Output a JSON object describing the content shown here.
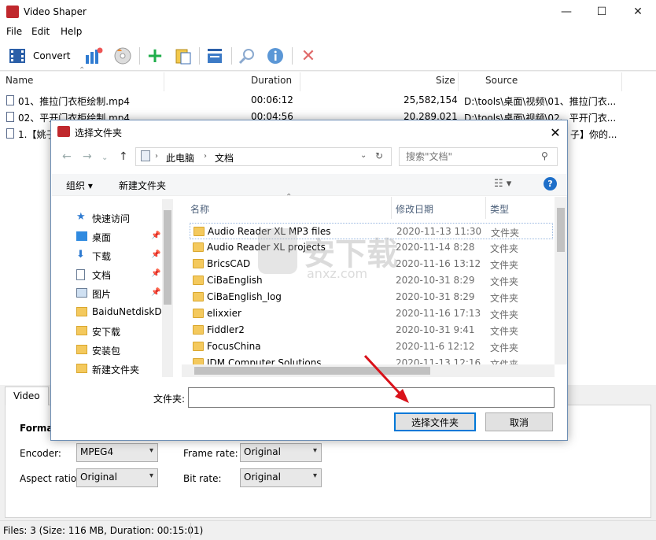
{
  "app": {
    "title": "Video Shaper"
  },
  "window_controls": {
    "minimize": "—",
    "maximize": "☐",
    "close": "✕"
  },
  "menu": [
    "File",
    "Edit",
    "Help"
  ],
  "toolbar": {
    "convert_label": "Convert"
  },
  "filelist": {
    "columns": [
      "Name",
      "Duration",
      "Size",
      "Source"
    ],
    "rows": [
      {
        "name": "01、推拉门衣柜绘制.mp4",
        "duration": "00:06:12",
        "size": "25,582,154",
        "source": "D:\\tools\\桌面\\视频\\01、推拉门衣..."
      },
      {
        "name": "02、平开门衣柜绘制.mp4",
        "duration": "00:04:56",
        "size": "20,289,021",
        "source": "D:\\tools\\桌面\\视频\\02、平开门衣..."
      },
      {
        "name": "1.【姚子",
        "duration": "",
        "size": "",
        "source": "子】你的..."
      }
    ]
  },
  "panel": {
    "tab": "Video",
    "format_label": "Forma",
    "encoder_label": "Encoder:",
    "encoder_value": "MPEG4",
    "framerate_label": "Frame rate:",
    "framerate_value": "Original",
    "aspect_label": "Aspect ratio:",
    "aspect_value": "Original",
    "bitrate_label": "Bit rate:",
    "bitrate_value": "Original"
  },
  "status": "Files: 3 (Size: 116 MB, Duration: 00:15:01)",
  "dialog": {
    "title": "选择文件夹",
    "address": [
      "此电脑",
      "文档"
    ],
    "search_placeholder": "搜索\"文档\"",
    "organize": "组织 ▾",
    "new_folder": "新建文件夹",
    "nav": [
      {
        "label": "快速访问",
        "icon": "star-icon"
      },
      {
        "label": "桌面",
        "icon": "desktop-icon",
        "pinned": true
      },
      {
        "label": "下载",
        "icon": "download-icon",
        "pinned": true
      },
      {
        "label": "文档",
        "icon": "document-icon",
        "pinned": true
      },
      {
        "label": "图片",
        "icon": "picture-icon",
        "pinned": true
      },
      {
        "label": "BaiduNetdiskD",
        "icon": "folder-icon"
      },
      {
        "label": "安下载",
        "icon": "folder-icon"
      },
      {
        "label": "安装包",
        "icon": "folder-icon"
      },
      {
        "label": "新建文件夹",
        "icon": "folder-icon"
      }
    ],
    "columns": [
      "名称",
      "修改日期",
      "类型"
    ],
    "items": [
      {
        "name": "Audio Reader XL MP3 files",
        "date": "2020-11-13 11:30",
        "type": "文件夹"
      },
      {
        "name": "Audio Reader XL projects",
        "date": "2020-11-14 8:28",
        "type": "文件夹"
      },
      {
        "name": "BricsCAD",
        "date": "2020-11-16 13:12",
        "type": "文件夹"
      },
      {
        "name": "CiBaEnglish",
        "date": "2020-10-31 8:29",
        "type": "文件夹"
      },
      {
        "name": "CiBaEnglish_log",
        "date": "2020-10-31 8:29",
        "type": "文件夹"
      },
      {
        "name": "elixxier",
        "date": "2020-11-16 17:13",
        "type": "文件夹"
      },
      {
        "name": "Fiddler2",
        "date": "2020-10-31 9:41",
        "type": "文件夹"
      },
      {
        "name": "FocusChina",
        "date": "2020-11-6 12:12",
        "type": "文件夹"
      },
      {
        "name": "IDM Computer Solutions",
        "date": "2020-11-13 12:16",
        "type": "文件夹"
      }
    ],
    "folder_label": "文件夹:",
    "folder_value": "",
    "select_button": "选择文件夹",
    "cancel_button": "取消"
  },
  "watermark": {
    "text": "安下载",
    "sub": "anxz.com"
  },
  "colors": {
    "accent": "#0078d7",
    "arrow": "#d9121a",
    "folder": "#f4c95d"
  }
}
